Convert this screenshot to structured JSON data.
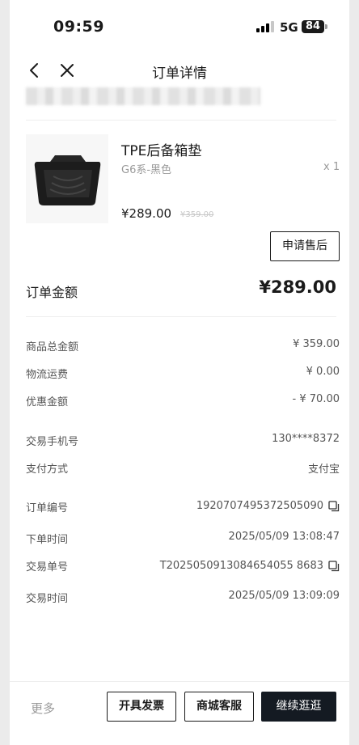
{
  "status_bar": {
    "time": "09:59",
    "network": "5G",
    "battery": "84"
  },
  "nav": {
    "title": "订单详情"
  },
  "product": {
    "name": "TPE后备箱垫",
    "variant": "G6系-黑色",
    "quantity": "x 1",
    "price": "¥289.00",
    "original_price": "¥359.00",
    "after_sale_label": "申请售后"
  },
  "order_total": {
    "label": "订单金额",
    "value": "¥289.00"
  },
  "summary": {
    "goods_total_label": "商品总金额",
    "goods_total_value": "¥ 359.00",
    "shipping_label": "物流运费",
    "shipping_value": "¥ 0.00",
    "discount_label": "优惠金额",
    "discount_value": "- ¥ 70.00"
  },
  "payment": {
    "phone_label": "交易手机号",
    "phone_value": "130****8372",
    "method_label": "支付方式",
    "method_value": "支付宝"
  },
  "order_info": {
    "order_no_label": "订单编号",
    "order_no_value": "1920707495372505090",
    "order_time_label": "下单时间",
    "order_time_value": "2025/05/09 13:08:47",
    "trade_no_label": "交易单号",
    "trade_no_value": "T2025050913084654055 8683",
    "trade_time_label": "交易时间",
    "trade_time_value": "2025/05/09 13:09:09"
  },
  "bottom_bar": {
    "more_label": "更多",
    "invoice_label": "开具发票",
    "service_label": "商城客服",
    "continue_label": "继续逛逛"
  },
  "icons": {
    "back": "chevron-left-icon",
    "close": "close-icon",
    "copy": "copy-icon"
  },
  "colors": {
    "primary_button": "#141a22",
    "muted_text": "#9a9a9a"
  }
}
